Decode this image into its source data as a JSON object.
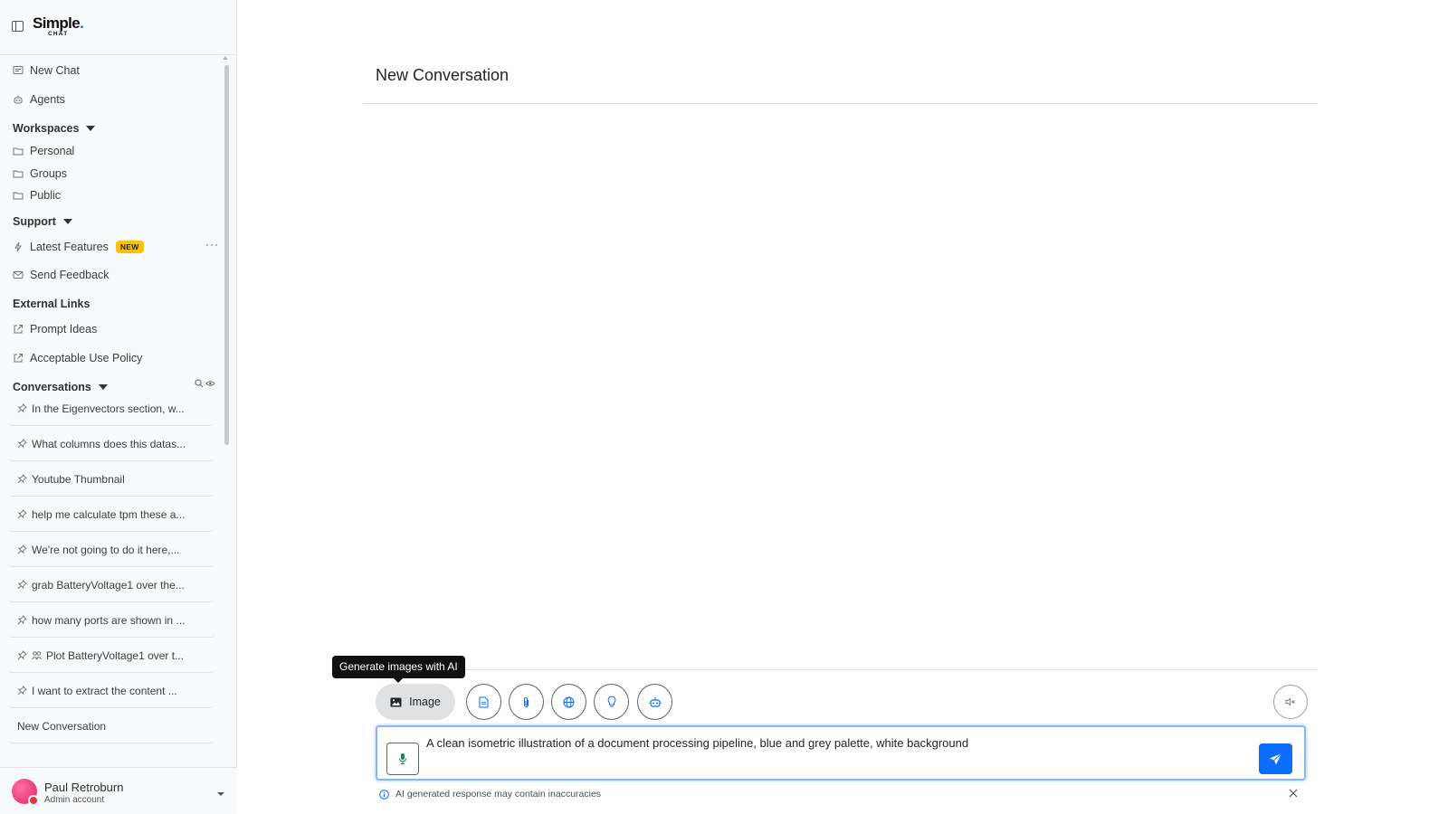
{
  "app": {
    "logo_main": "Simple",
    "logo_dot": ".",
    "logo_sub": "CHAT"
  },
  "sidebar": {
    "new_chat": "New Chat",
    "agents": "Agents",
    "workspaces": {
      "heading": "Workspaces",
      "items": [
        "Personal",
        "Groups",
        "Public"
      ]
    },
    "support": {
      "heading": "Support",
      "latest_features": "Latest Features",
      "badge": "NEW",
      "send_feedback": "Send Feedback",
      "more": "···"
    },
    "external_links": {
      "heading": "External Links",
      "items": [
        "Prompt Ideas",
        "Acceptable Use Policy"
      ]
    },
    "conversations": {
      "heading": "Conversations",
      "items": [
        "In the Eigenvectors section, w...",
        "What columns does this datas...",
        "Youtube Thumbnail",
        "help me calculate tpm these a...",
        "We're not going to do it here,...",
        "grab BatteryVoltage1 over the...",
        "how many ports are shown in ...",
        "Plot BatteryVoltage1 over t...",
        "I want to extract the content ..."
      ],
      "new_item": "New Conversation"
    }
  },
  "user": {
    "name": "Paul Retroburn",
    "role": "Admin account"
  },
  "main": {
    "title": "New Conversation",
    "tooltip": "Generate images with AI",
    "image_button": "Image",
    "tools": [
      "document-icon",
      "paperclip-icon",
      "globe-icon",
      "lightbulb-icon",
      "robot-icon"
    ],
    "composer_value": "A clean isometric illustration of a document processing pipeline, blue and grey palette, white background",
    "disclaimer": "AI generated response may contain inaccuracies"
  },
  "colors": {
    "accent": "#0d6efd",
    "badge": "#ffc107",
    "tooltip_bg": "#111111"
  }
}
